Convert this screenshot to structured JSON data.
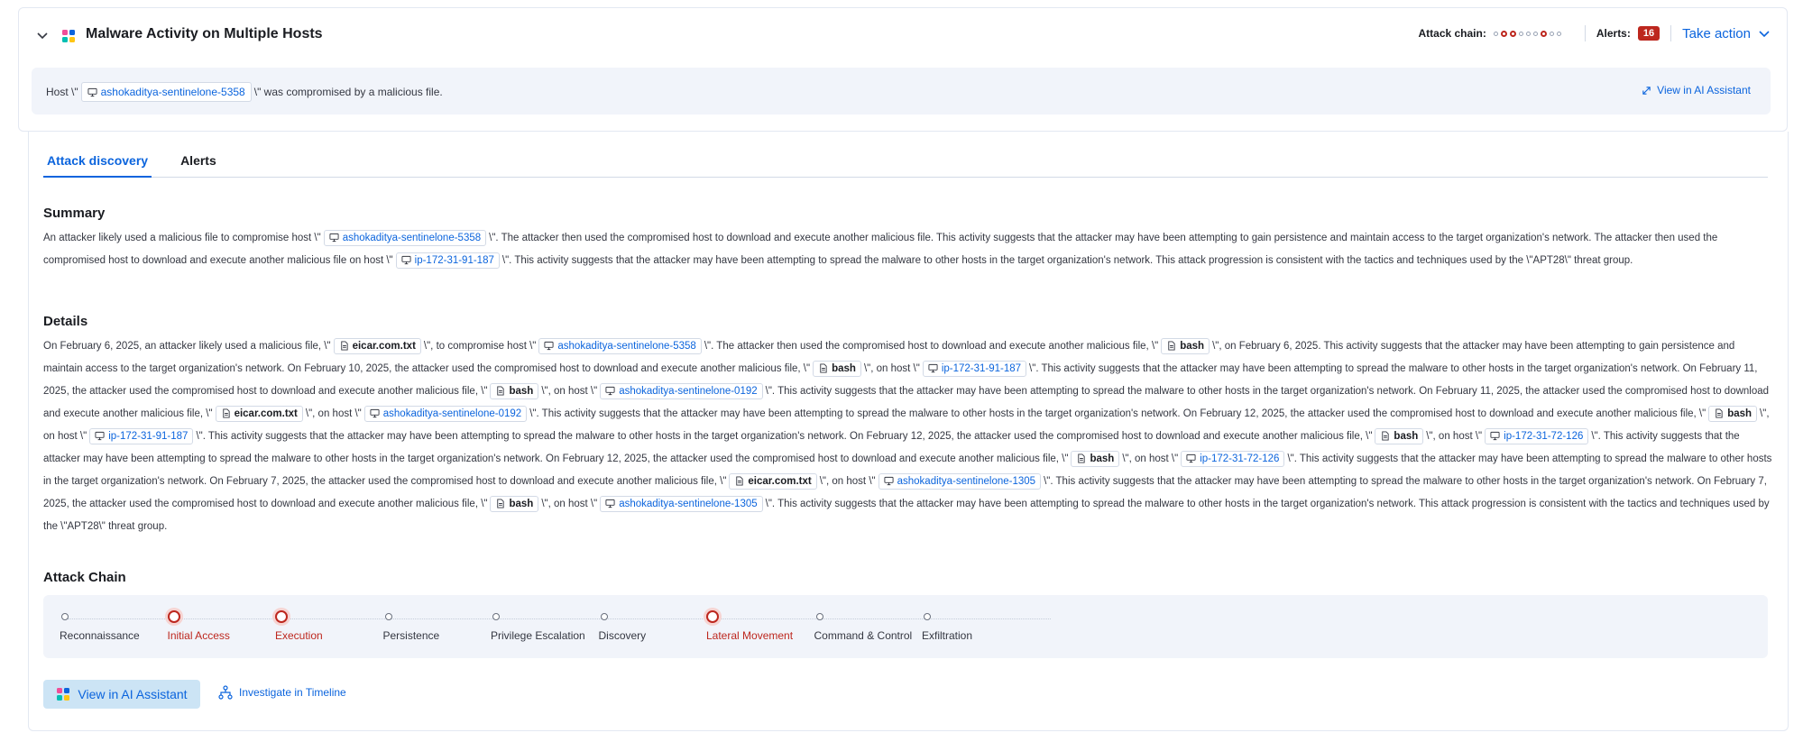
{
  "header": {
    "title": "Malware Activity on Multiple Hosts",
    "attack_chain_label": "Attack chain:",
    "attack_chain_dots": [
      false,
      true,
      true,
      false,
      false,
      false,
      true,
      false,
      false
    ],
    "alerts_label": "Alerts:",
    "alerts_count": "16",
    "take_action_label": "Take action",
    "accent_color": "#0b64dd",
    "danger_color": "#bd271e"
  },
  "host_bar": {
    "prefix": "Host \\\"",
    "host": "ashokaditya-sentinelone-5358",
    "suffix": "\\\" was compromised by a malicious file.",
    "ai_link": "View in AI Assistant"
  },
  "tabs": [
    {
      "label": "Attack discovery"
    },
    {
      "label": "Alerts"
    }
  ],
  "summary": {
    "title": "Summary",
    "segments": [
      {
        "t": "text",
        "v": "An attacker likely used a malicious file to compromise host \\\""
      },
      {
        "t": "host",
        "v": "ashokaditya-sentinelone-5358"
      },
      {
        "t": "text",
        "v": "\\\". The attacker then used the compromised host to download and execute another malicious file. This activity suggests that the attacker may have been attempting to gain persistence and maintain access to the target organization's network. The attacker then used the compromised host to download and execute another malicious file on host \\\""
      },
      {
        "t": "host",
        "v": "ip-172-31-91-187"
      },
      {
        "t": "text",
        "v": "\\\". This activity suggests that the attacker may have been attempting to spread the malware to other hosts in the target organization's network. This attack progression is consistent with the tactics and techniques used by the \\\"APT28\\\" threat group."
      }
    ]
  },
  "details": {
    "title": "Details",
    "segments": [
      {
        "t": "text",
        "v": "On February 6, 2025, an attacker likely used a malicious file, \\\""
      },
      {
        "t": "file",
        "v": "eicar.com.txt"
      },
      {
        "t": "text",
        "v": "\\\", to compromise host \\\""
      },
      {
        "t": "host",
        "v": "ashokaditya-sentinelone-5358"
      },
      {
        "t": "text",
        "v": "\\\". The attacker then used the compromised host to download and execute another malicious file, \\\""
      },
      {
        "t": "file",
        "v": "bash"
      },
      {
        "t": "text",
        "v": "\\\", on February 6, 2025. This activity suggests that the attacker may have been attempting to gain persistence and maintain access to the target organization's network. On February 10, 2025, the attacker used the compromised host to download and execute another malicious file, \\\""
      },
      {
        "t": "file",
        "v": "bash"
      },
      {
        "t": "text",
        "v": "\\\", on host \\\""
      },
      {
        "t": "host",
        "v": "ip-172-31-91-187"
      },
      {
        "t": "text",
        "v": "\\\". This activity suggests that the attacker may have been attempting to spread the malware to other hosts in the target organization's network. On February 11, 2025, the attacker used the compromised host to download and execute another malicious file, \\\""
      },
      {
        "t": "file",
        "v": "bash"
      },
      {
        "t": "text",
        "v": "\\\", on host \\\""
      },
      {
        "t": "host",
        "v": "ashokaditya-sentinelone-0192"
      },
      {
        "t": "text",
        "v": "\\\". This activity suggests that the attacker may have been attempting to spread the malware to other hosts in the target organization's network. On February 11, 2025, the attacker used the compromised host to download and execute another malicious file, \\\""
      },
      {
        "t": "file",
        "v": "eicar.com.txt"
      },
      {
        "t": "text",
        "v": "\\\", on host \\\""
      },
      {
        "t": "host",
        "v": "ashokaditya-sentinelone-0192"
      },
      {
        "t": "text",
        "v": "\\\". This activity suggests that the attacker may have been attempting to spread the malware to other hosts in the target organization's network. On February 12, 2025, the attacker used the compromised host to download and execute another malicious file, \\\""
      },
      {
        "t": "file",
        "v": "bash"
      },
      {
        "t": "text",
        "v": "\\\", on host \\\""
      },
      {
        "t": "host",
        "v": "ip-172-31-91-187"
      },
      {
        "t": "text",
        "v": "\\\". This activity suggests that the attacker may have been attempting to spread the malware to other hosts in the target organization's network. On February 12, 2025, the attacker used the compromised host to download and execute another malicious file, \\\""
      },
      {
        "t": "file",
        "v": "bash"
      },
      {
        "t": "text",
        "v": "\\\", on host \\\""
      },
      {
        "t": "host",
        "v": "ip-172-31-72-126"
      },
      {
        "t": "text",
        "v": "\\\". This activity suggests that the attacker may have been attempting to spread the malware to other hosts in the target organization's network. On February 12, 2025, the attacker used the compromised host to download and execute another malicious file, \\\""
      },
      {
        "t": "file",
        "v": "bash"
      },
      {
        "t": "text",
        "v": "\\\", on host \\\""
      },
      {
        "t": "host",
        "v": "ip-172-31-72-126"
      },
      {
        "t": "text",
        "v": "\\\". This activity suggests that the attacker may have been attempting to spread the malware to other hosts in the target organization's network. On February 7, 2025, the attacker used the compromised host to download and execute another malicious file, \\\""
      },
      {
        "t": "file",
        "v": "eicar.com.txt"
      },
      {
        "t": "text",
        "v": "\\\", on host \\\""
      },
      {
        "t": "host",
        "v": "ashokaditya-sentinelone-1305"
      },
      {
        "t": "text",
        "v": "\\\". This activity suggests that the attacker may have been attempting to spread the malware to other hosts in the target organization's network. On February 7, 2025, the attacker used the compromised host to download and execute another malicious file, \\\""
      },
      {
        "t": "file",
        "v": "bash"
      },
      {
        "t": "text",
        "v": "\\\", on host \\\""
      },
      {
        "t": "host",
        "v": "ashokaditya-sentinelone-1305"
      },
      {
        "t": "text",
        "v": "\\\". This activity suggests that the attacker may have been attempting to spread the malware to other hosts in the target organization's network. This attack progression is consistent with the tactics and techniques used by the \\\"APT28\\\" threat group."
      }
    ]
  },
  "attack_chain": {
    "title": "Attack Chain",
    "stages": [
      {
        "label": "Reconnaissance",
        "active": false
      },
      {
        "label": "Initial Access",
        "active": true
      },
      {
        "label": "Execution",
        "active": true
      },
      {
        "label": "Persistence",
        "active": false
      },
      {
        "label": "Privilege Escalation",
        "active": false
      },
      {
        "label": "Discovery",
        "active": false
      },
      {
        "label": "Lateral Movement",
        "active": true
      },
      {
        "label": "Command & Control",
        "active": false
      },
      {
        "label": "Exfiltration",
        "active": false
      }
    ]
  },
  "actions": {
    "ai_button": "View in AI Assistant",
    "timeline_button": "Investigate in Timeline"
  }
}
